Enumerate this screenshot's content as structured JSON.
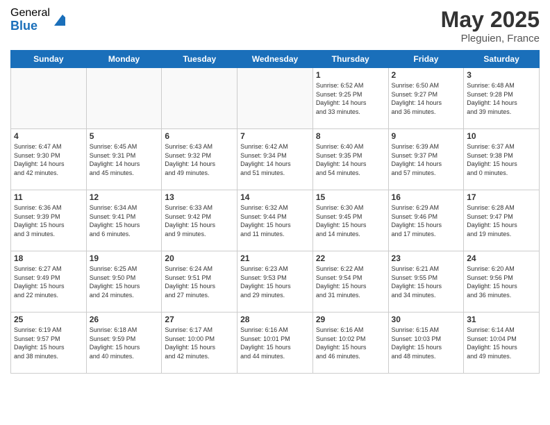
{
  "logo": {
    "general": "General",
    "blue": "Blue"
  },
  "title": {
    "month": "May 2025",
    "location": "Pleguien, France"
  },
  "days_of_week": [
    "Sunday",
    "Monday",
    "Tuesday",
    "Wednesday",
    "Thursday",
    "Friday",
    "Saturday"
  ],
  "weeks": [
    [
      {
        "day": "",
        "info": ""
      },
      {
        "day": "",
        "info": ""
      },
      {
        "day": "",
        "info": ""
      },
      {
        "day": "",
        "info": ""
      },
      {
        "day": "1",
        "info": "Sunrise: 6:52 AM\nSunset: 9:25 PM\nDaylight: 14 hours\nand 33 minutes."
      },
      {
        "day": "2",
        "info": "Sunrise: 6:50 AM\nSunset: 9:27 PM\nDaylight: 14 hours\nand 36 minutes."
      },
      {
        "day": "3",
        "info": "Sunrise: 6:48 AM\nSunset: 9:28 PM\nDaylight: 14 hours\nand 39 minutes."
      }
    ],
    [
      {
        "day": "4",
        "info": "Sunrise: 6:47 AM\nSunset: 9:30 PM\nDaylight: 14 hours\nand 42 minutes."
      },
      {
        "day": "5",
        "info": "Sunrise: 6:45 AM\nSunset: 9:31 PM\nDaylight: 14 hours\nand 45 minutes."
      },
      {
        "day": "6",
        "info": "Sunrise: 6:43 AM\nSunset: 9:32 PM\nDaylight: 14 hours\nand 49 minutes."
      },
      {
        "day": "7",
        "info": "Sunrise: 6:42 AM\nSunset: 9:34 PM\nDaylight: 14 hours\nand 51 minutes."
      },
      {
        "day": "8",
        "info": "Sunrise: 6:40 AM\nSunset: 9:35 PM\nDaylight: 14 hours\nand 54 minutes."
      },
      {
        "day": "9",
        "info": "Sunrise: 6:39 AM\nSunset: 9:37 PM\nDaylight: 14 hours\nand 57 minutes."
      },
      {
        "day": "10",
        "info": "Sunrise: 6:37 AM\nSunset: 9:38 PM\nDaylight: 15 hours\nand 0 minutes."
      }
    ],
    [
      {
        "day": "11",
        "info": "Sunrise: 6:36 AM\nSunset: 9:39 PM\nDaylight: 15 hours\nand 3 minutes."
      },
      {
        "day": "12",
        "info": "Sunrise: 6:34 AM\nSunset: 9:41 PM\nDaylight: 15 hours\nand 6 minutes."
      },
      {
        "day": "13",
        "info": "Sunrise: 6:33 AM\nSunset: 9:42 PM\nDaylight: 15 hours\nand 9 minutes."
      },
      {
        "day": "14",
        "info": "Sunrise: 6:32 AM\nSunset: 9:44 PM\nDaylight: 15 hours\nand 11 minutes."
      },
      {
        "day": "15",
        "info": "Sunrise: 6:30 AM\nSunset: 9:45 PM\nDaylight: 15 hours\nand 14 minutes."
      },
      {
        "day": "16",
        "info": "Sunrise: 6:29 AM\nSunset: 9:46 PM\nDaylight: 15 hours\nand 17 minutes."
      },
      {
        "day": "17",
        "info": "Sunrise: 6:28 AM\nSunset: 9:47 PM\nDaylight: 15 hours\nand 19 minutes."
      }
    ],
    [
      {
        "day": "18",
        "info": "Sunrise: 6:27 AM\nSunset: 9:49 PM\nDaylight: 15 hours\nand 22 minutes."
      },
      {
        "day": "19",
        "info": "Sunrise: 6:25 AM\nSunset: 9:50 PM\nDaylight: 15 hours\nand 24 minutes."
      },
      {
        "day": "20",
        "info": "Sunrise: 6:24 AM\nSunset: 9:51 PM\nDaylight: 15 hours\nand 27 minutes."
      },
      {
        "day": "21",
        "info": "Sunrise: 6:23 AM\nSunset: 9:53 PM\nDaylight: 15 hours\nand 29 minutes."
      },
      {
        "day": "22",
        "info": "Sunrise: 6:22 AM\nSunset: 9:54 PM\nDaylight: 15 hours\nand 31 minutes."
      },
      {
        "day": "23",
        "info": "Sunrise: 6:21 AM\nSunset: 9:55 PM\nDaylight: 15 hours\nand 34 minutes."
      },
      {
        "day": "24",
        "info": "Sunrise: 6:20 AM\nSunset: 9:56 PM\nDaylight: 15 hours\nand 36 minutes."
      }
    ],
    [
      {
        "day": "25",
        "info": "Sunrise: 6:19 AM\nSunset: 9:57 PM\nDaylight: 15 hours\nand 38 minutes."
      },
      {
        "day": "26",
        "info": "Sunrise: 6:18 AM\nSunset: 9:59 PM\nDaylight: 15 hours\nand 40 minutes."
      },
      {
        "day": "27",
        "info": "Sunrise: 6:17 AM\nSunset: 10:00 PM\nDaylight: 15 hours\nand 42 minutes."
      },
      {
        "day": "28",
        "info": "Sunrise: 6:16 AM\nSunset: 10:01 PM\nDaylight: 15 hours\nand 44 minutes."
      },
      {
        "day": "29",
        "info": "Sunrise: 6:16 AM\nSunset: 10:02 PM\nDaylight: 15 hours\nand 46 minutes."
      },
      {
        "day": "30",
        "info": "Sunrise: 6:15 AM\nSunset: 10:03 PM\nDaylight: 15 hours\nand 48 minutes."
      },
      {
        "day": "31",
        "info": "Sunrise: 6:14 AM\nSunset: 10:04 PM\nDaylight: 15 hours\nand 49 minutes."
      }
    ]
  ]
}
